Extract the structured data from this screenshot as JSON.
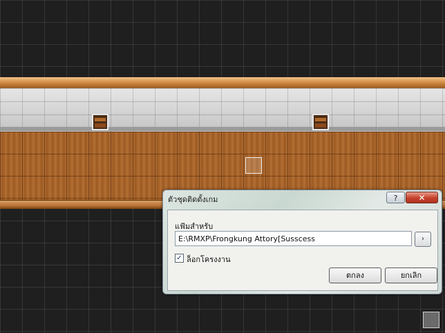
{
  "dialog": {
    "title": "ตัวชุดติดตั้งเกม",
    "help_glyph": "?",
    "close_glyph": "✕",
    "folder_label": "แฟ้มสำหรับ",
    "path_value": "E:\\RMXP\\Frongkung Attory[Susscess",
    "browse_glyph": "›",
    "checkbox_checked": true,
    "checkbox_mark": "✓",
    "checkbox_label": "ล็อกโครงงาน",
    "ok_label": "ตกลง",
    "cancel_label": "ยกเลิก"
  },
  "scene": {
    "colors": {
      "background": "#1f1f1f",
      "stone_wall": "#cfcfcf",
      "wood_floor": "#a8652a",
      "close_button": "#c4412c"
    },
    "icons": [
      "chest-icon",
      "chest-icon"
    ]
  }
}
